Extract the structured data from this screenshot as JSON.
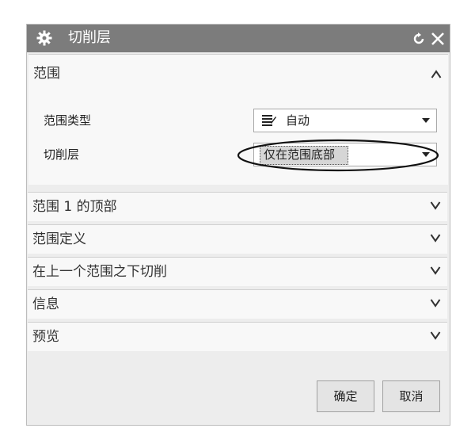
{
  "dialog": {
    "title": "切削层",
    "reset_icon": "reset-icon",
    "close_icon": "close-icon"
  },
  "sections": {
    "range": {
      "label": "范围",
      "state": "expanded"
    },
    "range_type": {
      "label": "范围类型",
      "value": "自动",
      "icon": "list-icon"
    },
    "cut_levels": {
      "label": "切削层",
      "value": "仅在范围底部"
    },
    "top_of_range": {
      "label": "范围 1 的顶部"
    },
    "range_definition": {
      "label": "范围定义"
    },
    "cut_below": {
      "label": "在上一个范围之下切削"
    },
    "info": {
      "label": "信息"
    },
    "preview": {
      "label": "预览"
    }
  },
  "buttons": {
    "ok": "确定",
    "cancel": "取消"
  },
  "colors": {
    "titlebar": "#7c7c7c",
    "panel": "#ededed",
    "section": "#f8f8f8"
  }
}
